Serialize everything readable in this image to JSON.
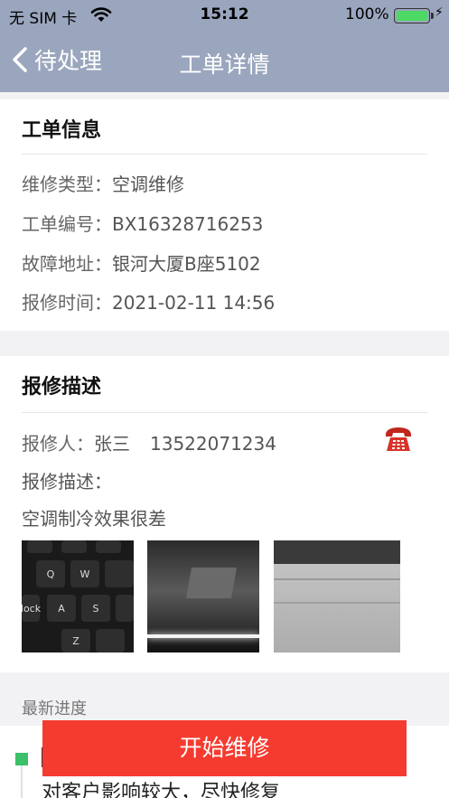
{
  "status_bar": {
    "carrier": "无 SIM 卡",
    "time": "15:12",
    "battery_percent": "100%",
    "battery_level": 1.0,
    "battery_color": "#4cd964"
  },
  "nav": {
    "back_label": "待处理",
    "title": "工单详情",
    "background": "#9aa6bd"
  },
  "order_info": {
    "heading": "工单信息",
    "rows": [
      {
        "label": "维修类型：",
        "value": "空调维修"
      },
      {
        "label": "工单编号：",
        "value": "BX16328716253"
      },
      {
        "label": "故障地址：",
        "value": "银河大厦B座5102"
      },
      {
        "label": "报修时间：",
        "value": "2021-02-11 14:56"
      }
    ]
  },
  "report": {
    "heading": "报修描述",
    "reporter_label": "报修人：",
    "reporter_name": "张三",
    "reporter_phone": "13522071234",
    "description_label": "报修描述：",
    "description": "空调制冷效果很差",
    "phone_icon": "telephone-icon",
    "keyboard_keys": [
      "Q",
      "W",
      "A",
      "S",
      "Z",
      "lock"
    ]
  },
  "progress": {
    "section_label": "最新进度",
    "latest_text": "对客户影响较大，尽快修复",
    "status_color": "#3cc06a"
  },
  "action": {
    "start_label": "开始维修",
    "color": "#f53b2f"
  }
}
